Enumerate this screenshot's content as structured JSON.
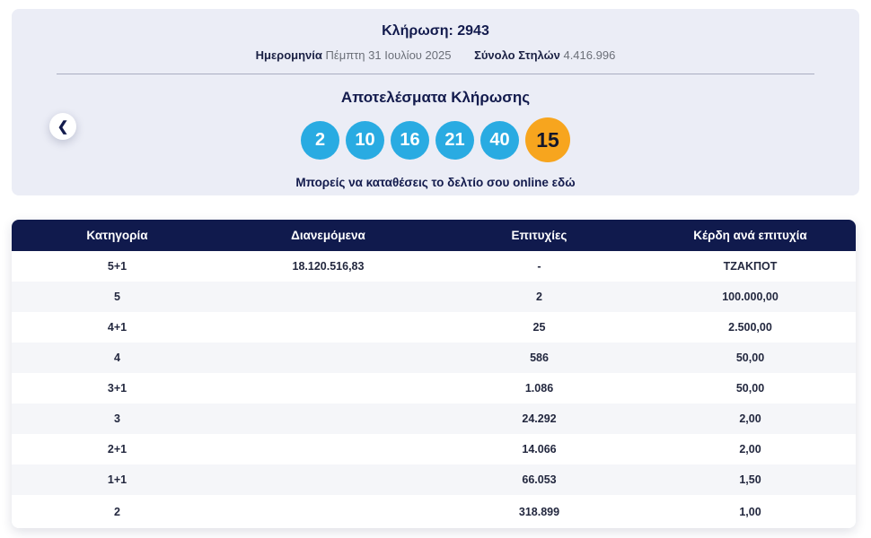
{
  "banner": {
    "title": "Κλήρωση: 2943",
    "date_label": "Ημερομηνία",
    "date_value": "Πέμπτη 31 Ιουλίου 2025",
    "columns_label": "Σύνολο Στηλών",
    "columns_value": "4.416.996",
    "results_title": "Αποτελέσματα Κλήρωσης",
    "numbers": [
      {
        "value": "2",
        "type": "main"
      },
      {
        "value": "10",
        "type": "main"
      },
      {
        "value": "16",
        "type": "main"
      },
      {
        "value": "21",
        "type": "main"
      },
      {
        "value": "40",
        "type": "main"
      },
      {
        "value": "15",
        "type": "bonus"
      }
    ],
    "cta_text": "Μπορείς να καταθέσεις το δελτίο σου online εδώ",
    "prev_arrow": "❮"
  },
  "table": {
    "headers": [
      "Κατηγορία",
      "Διανεμόμενα",
      "Επιτυχίες",
      "Κέρδη ανά επιτυχία"
    ],
    "rows": [
      [
        "5+1",
        "18.120.516,83",
        "-",
        "ΤΖΑΚΠΟΤ"
      ],
      [
        "5",
        "",
        "2",
        "100.000,00"
      ],
      [
        "4+1",
        "",
        "25",
        "2.500,00"
      ],
      [
        "4",
        "",
        "586",
        "50,00"
      ],
      [
        "3+1",
        "",
        "1.086",
        "50,00"
      ],
      [
        "3",
        "",
        "24.292",
        "2,00"
      ],
      [
        "2+1",
        "",
        "14.066",
        "2,00"
      ],
      [
        "1+1",
        "",
        "66.053",
        "1,50"
      ],
      [
        "2",
        "",
        "318.899",
        "1,00"
      ]
    ]
  },
  "colors": {
    "main_ball": "#29abe2",
    "bonus_ball": "#f7a51e",
    "header_navy": "#101a4d",
    "banner_background": "#ebedf6",
    "row_alternate": "#f5f6f9",
    "muted_text": "#6b6f78"
  }
}
